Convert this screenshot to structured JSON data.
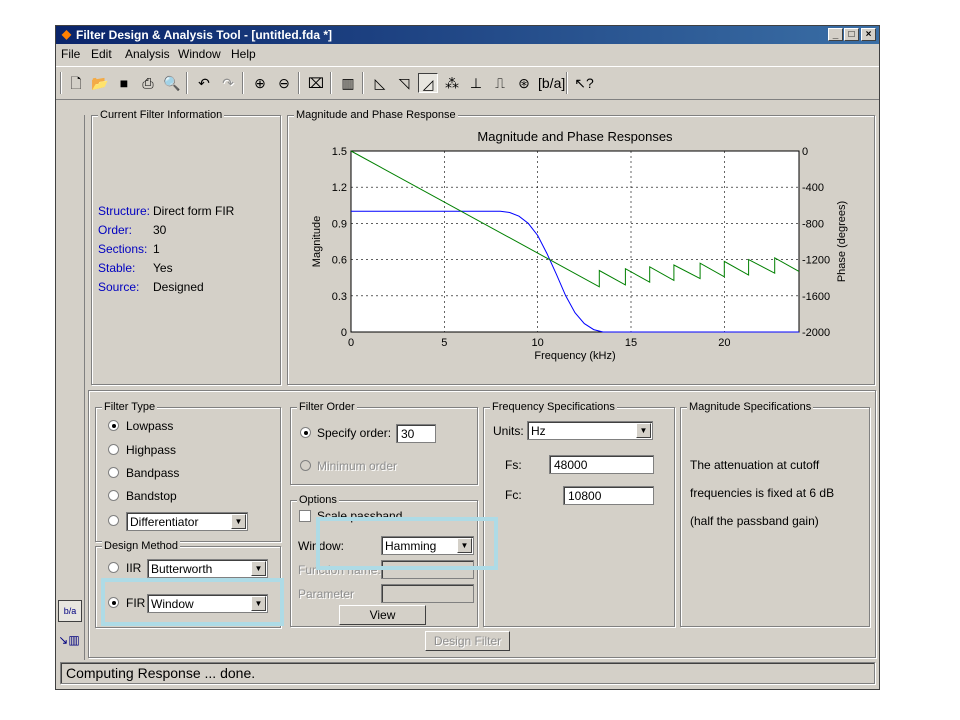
{
  "window": {
    "title": "Filter Design & Analysis Tool - [untitled.fda *]",
    "controls": [
      "_",
      "□",
      "×"
    ]
  },
  "menu": [
    "File",
    "Edit",
    "Analysis",
    "Window",
    "Help"
  ],
  "toolbar_icons": [
    "new-icon",
    "open-icon",
    "save-icon",
    "print-icon",
    "print-preview-icon",
    "undo-icon",
    "redo-icon",
    "zoom-in-icon",
    "zoom-out-icon",
    "full-view-icon",
    "filter-specs-icon",
    "magnitude-response-icon",
    "phase-response-icon",
    "magnitude-phase-icon",
    "group-delay-icon",
    "impulse-response-icon",
    "step-response-icon",
    "pole-zero-icon",
    "filter-coefficients-icon",
    "whats-this-icon"
  ],
  "current_filter": {
    "legend": "Current Filter Information",
    "rows": [
      {
        "label": "Structure:",
        "value": "Direct form FIR"
      },
      {
        "label": "Order:",
        "value": "30"
      },
      {
        "label": "Sections:",
        "value": "1"
      },
      {
        "label": "Stable:",
        "value": "Yes"
      },
      {
        "label": "Source:",
        "value": "Designed"
      }
    ]
  },
  "response_panel": {
    "legend": "Magnitude and Phase Response"
  },
  "chart_data": {
    "type": "line",
    "title": "Magnitude and Phase  Responses",
    "xlabel": "Frequency (kHz)",
    "ylabel": "Magnitude",
    "y2label": "Phase (degrees)",
    "xlim": [
      0,
      24
    ],
    "ylim": [
      0,
      1.5
    ],
    "y2lim": [
      -2000,
      0
    ],
    "xticks": [
      "0",
      "5",
      "10",
      "15",
      "20"
    ],
    "yticks": [
      "0",
      "0.3",
      "0.6",
      "0.9",
      "1.2",
      "1.5"
    ],
    "y2ticks": [
      "0",
      "-400",
      "-800",
      "-1200",
      "-1600",
      "-2000"
    ],
    "grid": true,
    "series": [
      {
        "axis": "left",
        "color": "#0000ff",
        "x": [
          0,
          8,
          8.5,
          9,
          9.5,
          10,
          10.5,
          11,
          11.5,
          12,
          12.5,
          13,
          13.5,
          14,
          24
        ],
        "y": [
          1.0,
          1.0,
          0.99,
          0.96,
          0.9,
          0.8,
          0.65,
          0.48,
          0.3,
          0.16,
          0.07,
          0.02,
          0.0,
          0.0,
          0.0
        ]
      },
      {
        "axis": "right",
        "color": "#008000",
        "x": [
          0,
          13.3,
          13.3,
          14.7,
          14.7,
          16.0,
          16.0,
          17.3,
          17.3,
          18.7,
          18.7,
          20.0,
          20.0,
          21.3,
          21.3,
          22.7,
          22.7,
          24
        ],
        "y": [
          0,
          -1500,
          -1320,
          -1480,
          -1300,
          -1450,
          -1280,
          -1430,
          -1260,
          -1410,
          -1240,
          -1390,
          -1220,
          -1370,
          -1200,
          -1350,
          -1180,
          -1330
        ]
      }
    ]
  },
  "filter_type": {
    "legend": "Filter Type",
    "options": [
      "Lowpass",
      "Highpass",
      "Bandpass",
      "Bandstop"
    ],
    "selected": "Lowpass",
    "other_value": "Differentiator"
  },
  "design_method": {
    "legend": "Design Method",
    "iir_label": "IIR",
    "iir_value": "Butterworth",
    "fir_label": "FIR",
    "fir_value": "Window",
    "selected": "FIR"
  },
  "filter_order": {
    "legend": "Filter Order",
    "specify_label": "Specify order:",
    "specify_value": "30",
    "minimum_label": "Minimum order"
  },
  "options": {
    "legend": "Options",
    "scale_passband_label": "Scale passband",
    "window_label": "Window:",
    "window_value": "Hamming",
    "function_name_label": "Function name:",
    "parameter_label": "Parameter",
    "view_label": "View"
  },
  "freq_specs": {
    "legend": "Frequency Specifications",
    "units_label": "Units:",
    "units_value": "Hz",
    "fs_label": "Fs:",
    "fs_value": "48000",
    "fc_label": "Fc:",
    "fc_value": "10800"
  },
  "mag_specs": {
    "legend": "Magnitude Specifications",
    "lines": [
      "The attenuation at cutoff",
      "frequencies is fixed at 6 dB",
      "(half the passband gain)"
    ]
  },
  "design_button": "Design Filter",
  "status": "Computing Response ... done."
}
